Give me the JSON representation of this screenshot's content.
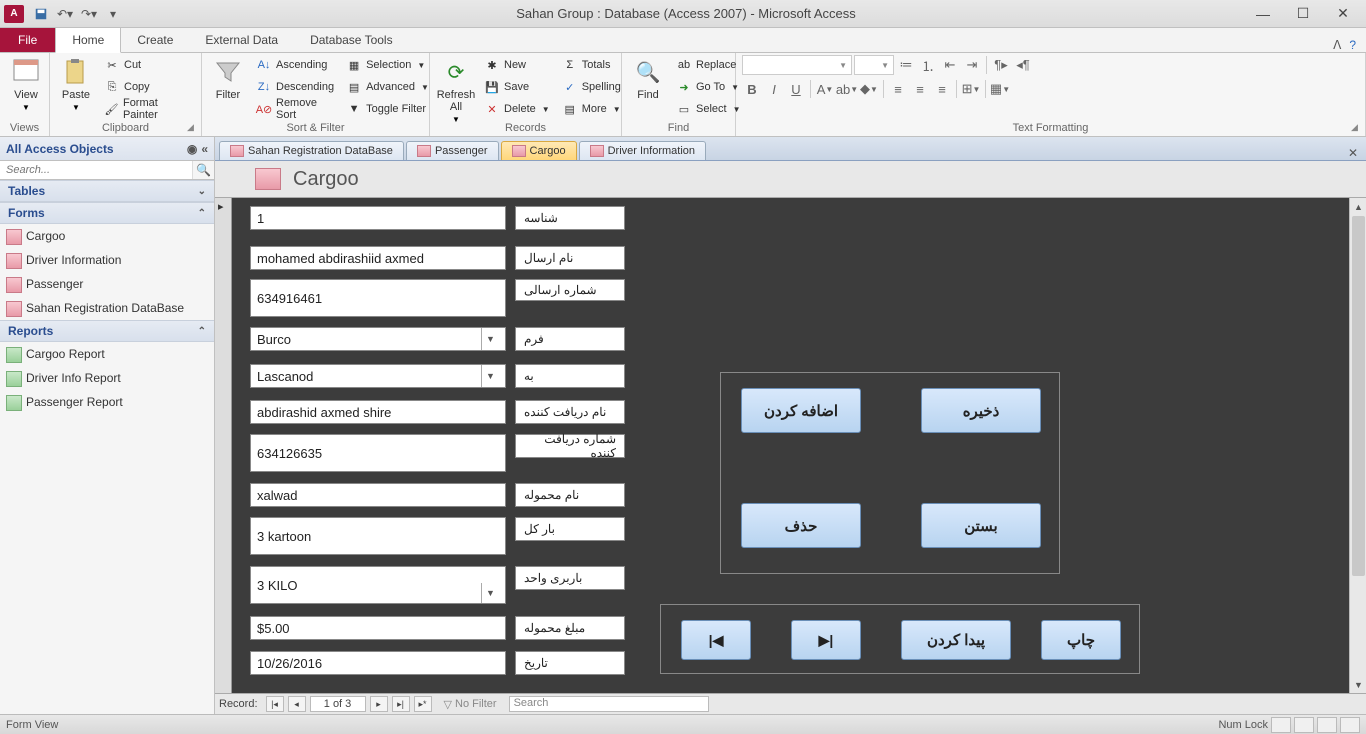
{
  "title": "Sahan Group : Database (Access 2007)  -  Microsoft Access",
  "ribbon_tabs": {
    "file": "File",
    "home": "Home",
    "create": "Create",
    "external": "External Data",
    "tools": "Database Tools"
  },
  "ribbon_groups": {
    "views": "Views",
    "clipboard": "Clipboard",
    "sortfilter": "Sort & Filter",
    "records": "Records",
    "find": "Find",
    "text": "Text Formatting"
  },
  "ribbon_cmds": {
    "view": "View",
    "paste": "Paste",
    "cut": "Cut",
    "copy": "Copy",
    "fmtpainter": "Format Painter",
    "filter": "Filter",
    "asc": "Ascending",
    "desc": "Descending",
    "removesort": "Remove Sort",
    "selection": "Selection",
    "advanced": "Advanced",
    "togglefilter": "Toggle Filter",
    "refresh": "Refresh\nAll",
    "new": "New",
    "save": "Save",
    "delete": "Delete",
    "totals": "Totals",
    "spelling": "Spelling",
    "more": "More",
    "find": "Find",
    "replace": "Replace",
    "goto": "Go To",
    "select": "Select"
  },
  "nav": {
    "header": "All Access Objects",
    "search_placeholder": "Search...",
    "sections": {
      "tables": "Tables",
      "forms": "Forms",
      "reports": "Reports"
    },
    "forms": [
      "Cargoo",
      "Driver Information",
      "Passenger",
      "Sahan Registration DataBase"
    ],
    "reports": [
      "Cargoo Report",
      "Driver Info Report",
      "Passenger Report"
    ]
  },
  "doc_tabs": {
    "t1": "Sahan Registration DataBase",
    "t2": "Passenger",
    "t3": "Cargoo",
    "t4": "Driver Information"
  },
  "form_title": "Cargoo",
  "fields": {
    "id": {
      "label": "شناسه",
      "value": "1"
    },
    "sender_name": {
      "label": "نام ارسال",
      "value": "mohamed abdirashiid axmed"
    },
    "sender_num": {
      "label": "شماره ارسالی",
      "value": "634916461"
    },
    "from": {
      "label": "فرم",
      "value": "Burco"
    },
    "to": {
      "label": "به",
      "value": "Lascanod"
    },
    "receiver_name": {
      "label": "نام دریافت کننده",
      "value": "abdirashid axmed shire"
    },
    "receiver_num": {
      "label": "شماره دریافت کننده",
      "value": "634126635"
    },
    "cargo_name": {
      "label": "نام محموله",
      "value": "xalwad"
    },
    "total_load": {
      "label": "بار کل",
      "value": " 3 kartoon"
    },
    "unit_load": {
      "label": "باربری واحد",
      "value": "3 KILO"
    },
    "amount": {
      "label": "مبلغ محموله",
      "value": "$5.00"
    },
    "date": {
      "label": "تاریخ",
      "value": "10/26/2016"
    }
  },
  "buttons": {
    "add": "اضافه کردن",
    "save": "ذخیره",
    "delete": "حذف",
    "close": "بستن",
    "find": "پیدا کردن",
    "print": "چاپ"
  },
  "record_nav": {
    "label": "Record:",
    "pos": "1 of 3",
    "nofilter": "No Filter",
    "search": "Search"
  },
  "status": {
    "left": "Form View",
    "numlock": "Num Lock"
  }
}
